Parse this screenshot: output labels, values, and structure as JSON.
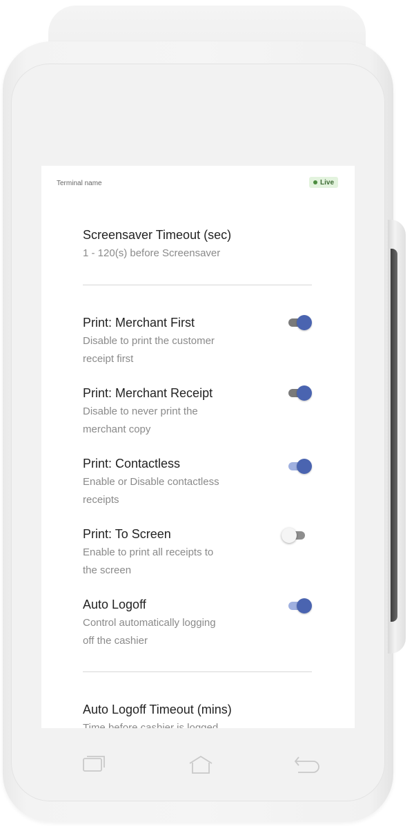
{
  "status_bar": {
    "terminal_name": "Terminal name",
    "live_label": "Live"
  },
  "settings": [
    {
      "title": "Screensaver Timeout (sec)",
      "description": "1 - 120(s) before Screensaver"
    },
    {
      "title": "Print: Merchant First",
      "description_lines": [
        "Disable to print the customer",
        "receipt first"
      ],
      "toggle": "on"
    },
    {
      "title": "Print: Merchant Receipt",
      "description_lines": [
        "Disable to never print the",
        "merchant copy"
      ],
      "toggle": "on"
    },
    {
      "title": "Print: Contactless",
      "description_lines": [
        "Enable or Disable contactless",
        "receipts"
      ],
      "toggle": "on"
    },
    {
      "title": "Print: To Screen",
      "description_lines": [
        "Enable to print all receipts to",
        "the screen"
      ],
      "toggle": "off"
    },
    {
      "title": "Auto Logoff",
      "description_lines": [
        "Control automatically logging",
        "off the cashier"
      ],
      "toggle": "on"
    },
    {
      "title": "Auto Logoff Timeout (mins)",
      "description": "Time before cashier is logged"
    }
  ],
  "nav": {
    "recent_icon": "recent-apps-icon",
    "home_icon": "home-icon",
    "back_icon": "back-icon"
  },
  "colors": {
    "accent": "#4a64b0",
    "live_badge_bg": "#e3f3de",
    "live_badge_text": "#3d6b34"
  }
}
